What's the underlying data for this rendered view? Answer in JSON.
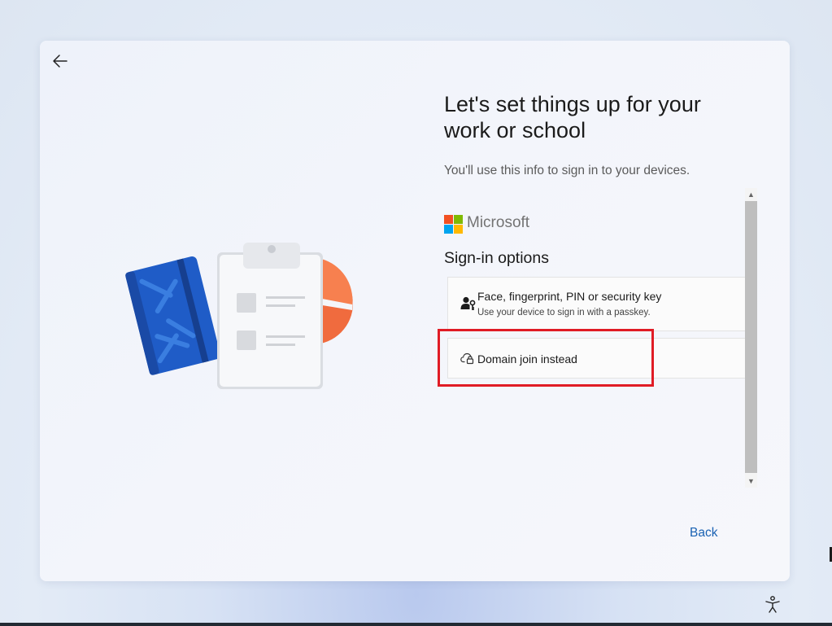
{
  "setup": {
    "heading": "Let's set things up for your work or school",
    "subtitle": "You'll use this info to sign in to your devices.",
    "brand": "Microsoft",
    "brand_colors": [
      "#f25022",
      "#7fba00",
      "#00a4ef",
      "#ffb900"
    ],
    "signin_heading": "Sign-in options",
    "options": [
      {
        "title": "Face, fingerprint, PIN or security key",
        "subtitle": "Use your device to sign in with a passkey.",
        "icon": "person-key-icon"
      },
      {
        "title": "Domain join instead",
        "icon": "cloud-lock-icon"
      }
    ],
    "back_label": "Back",
    "highlight_color": "#e01c25",
    "accent_color": "#1a62b3"
  }
}
